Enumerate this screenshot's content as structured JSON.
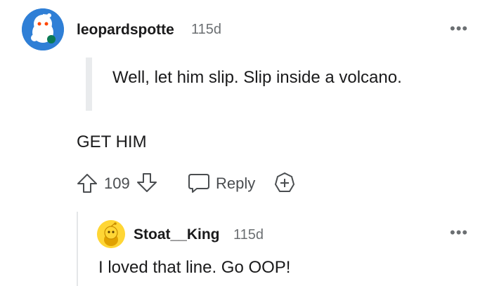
{
  "comment": {
    "author": "leopardspotte",
    "age": "115d",
    "more_glyph": "•••",
    "quote": "Well, let him slip. Slip inside a volcano.",
    "body": "GET HIM",
    "score": "109",
    "reply_label": "Reply",
    "icons": {
      "upvote": "arrow-up-icon",
      "downvote": "arrow-down-icon",
      "reply": "speech-bubble-icon",
      "award": "plus-circle-icon"
    }
  },
  "reply": {
    "author": "Stoat__King",
    "age": "115d",
    "more_glyph": "•••",
    "body": "I loved that line. Go OOP!"
  },
  "colors": {
    "avatar1_bg": "#2f7fd6",
    "avatar2_bg": "#ffd635",
    "meta_gray": "#6b6f72"
  }
}
